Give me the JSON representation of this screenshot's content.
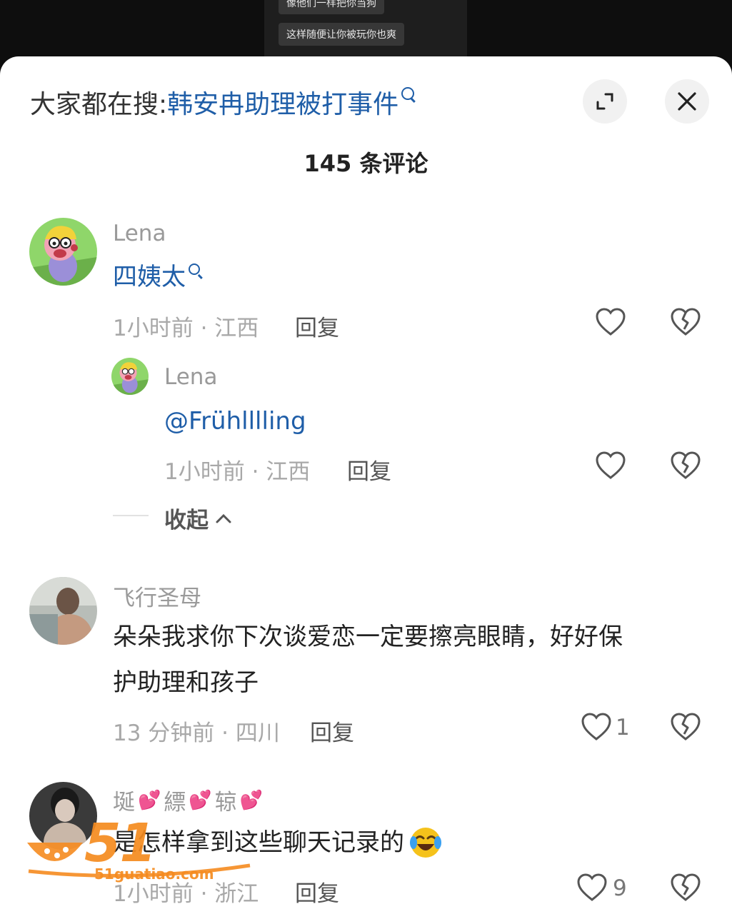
{
  "video": {
    "caption_1": "像他们一样把你当狗",
    "caption_2": "这样随便让你被玩你也爽"
  },
  "header": {
    "search_label": "大家都在搜:",
    "search_term": "韩安冉助理被打事件"
  },
  "comment_count": "145 条评论",
  "comments": [
    {
      "user": "Lena",
      "text": "四姨太",
      "meta": "1小时前 · 江西",
      "reply": "回复",
      "likes": "",
      "replies": [
        {
          "user": "Lena",
          "text": "@Frühlllling",
          "meta": "1小时前 · 江西",
          "reply": "回复",
          "likes": ""
        }
      ],
      "collapse": "收起"
    },
    {
      "user": "飞行圣母",
      "text_line1": "朵朵我求你下次谈爱恋一定要擦亮眼睛，好好保",
      "text_line2": "护助理和孩子",
      "meta": "13 分钟前 · 四川",
      "reply": "回复",
      "likes": "1"
    },
    {
      "user_parts": [
        "埏",
        "縹",
        "辌"
      ],
      "text": "是怎样拿到这些聊天记录的",
      "meta": "1小时前 · 浙江",
      "reply": "回复",
      "likes": "9"
    }
  ],
  "watermark": {
    "number": "51",
    "url": "51guatiao.com"
  },
  "colors": {
    "link": "#1f5ea8",
    "watermark": "#f58b1f"
  }
}
